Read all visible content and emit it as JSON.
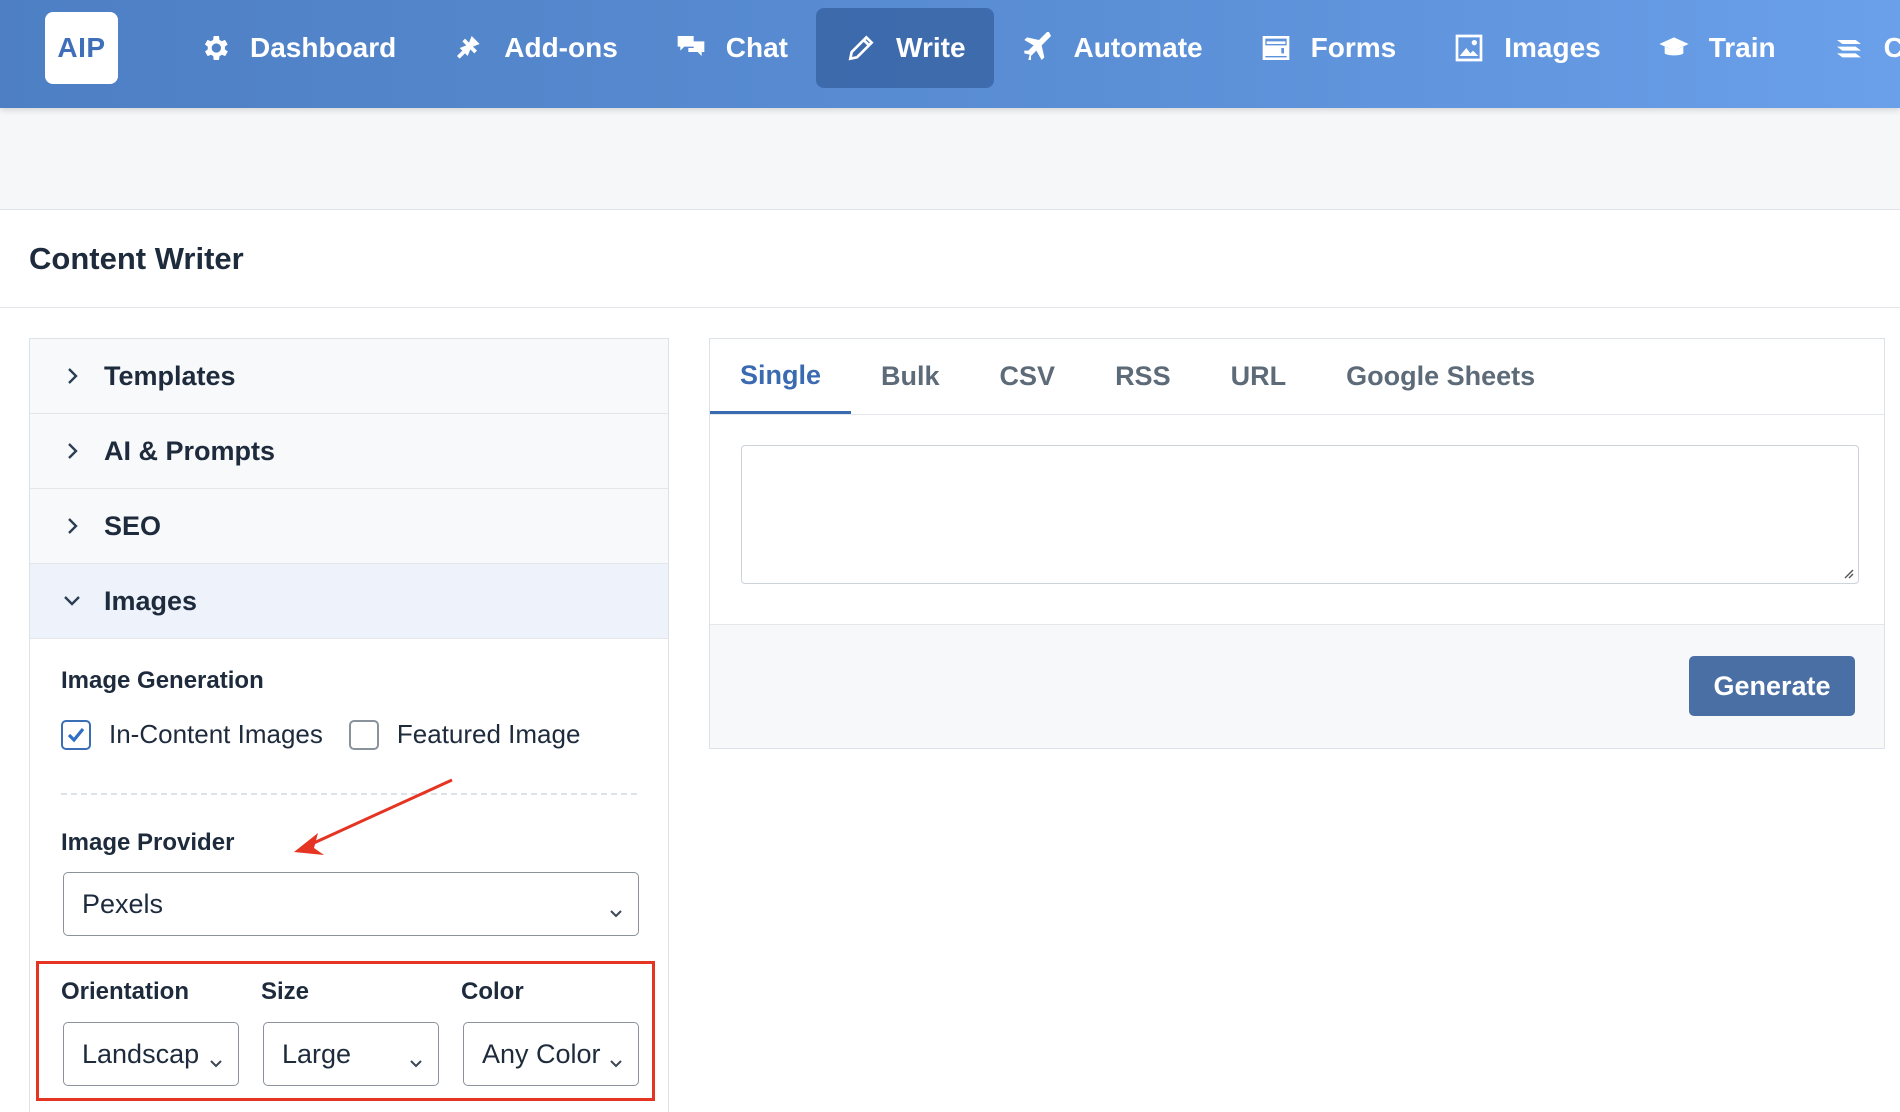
{
  "app": {
    "logo_text": "AIP"
  },
  "nav": {
    "items": [
      {
        "label": "Dashboard",
        "icon": "gear-icon"
      },
      {
        "label": "Add-ons",
        "icon": "plug-icon"
      },
      {
        "label": "Chat",
        "icon": "chat-icon"
      },
      {
        "label": "Write",
        "icon": "pencil-icon",
        "active": true
      },
      {
        "label": "Automate",
        "icon": "plane-icon"
      },
      {
        "label": "Forms",
        "icon": "form-icon"
      },
      {
        "label": "Images",
        "icon": "image-icon"
      },
      {
        "label": "Train",
        "icon": "graduation-cap-icon"
      },
      {
        "label": "Cred",
        "icon": "cred-icon"
      }
    ]
  },
  "page": {
    "title": "Content Writer"
  },
  "accordion": {
    "sections": [
      {
        "label": "Templates",
        "open": false
      },
      {
        "label": "AI & Prompts",
        "open": false
      },
      {
        "label": "SEO",
        "open": false
      },
      {
        "label": "Images",
        "open": true
      }
    ]
  },
  "images_panel": {
    "generation_label": "Image Generation",
    "in_content_label": "In-Content Images",
    "in_content_checked": true,
    "featured_label": "Featured Image",
    "featured_checked": false,
    "provider_label": "Image Provider",
    "provider_value": "Pexels",
    "orientation_label": "Orientation",
    "orientation_value": "Landscap",
    "size_label": "Size",
    "size_value": "Large",
    "color_label": "Color",
    "color_value": "Any Color"
  },
  "writer": {
    "tabs": [
      {
        "label": "Single",
        "active": true
      },
      {
        "label": "Bulk"
      },
      {
        "label": "CSV"
      },
      {
        "label": "RSS"
      },
      {
        "label": "URL"
      },
      {
        "label": "Google Sheets"
      }
    ],
    "textarea_value": "",
    "generate_label": "Generate"
  },
  "colors": {
    "accent": "#3a6ab0",
    "annotation": "#e53422",
    "button": "#4a6fa5"
  }
}
